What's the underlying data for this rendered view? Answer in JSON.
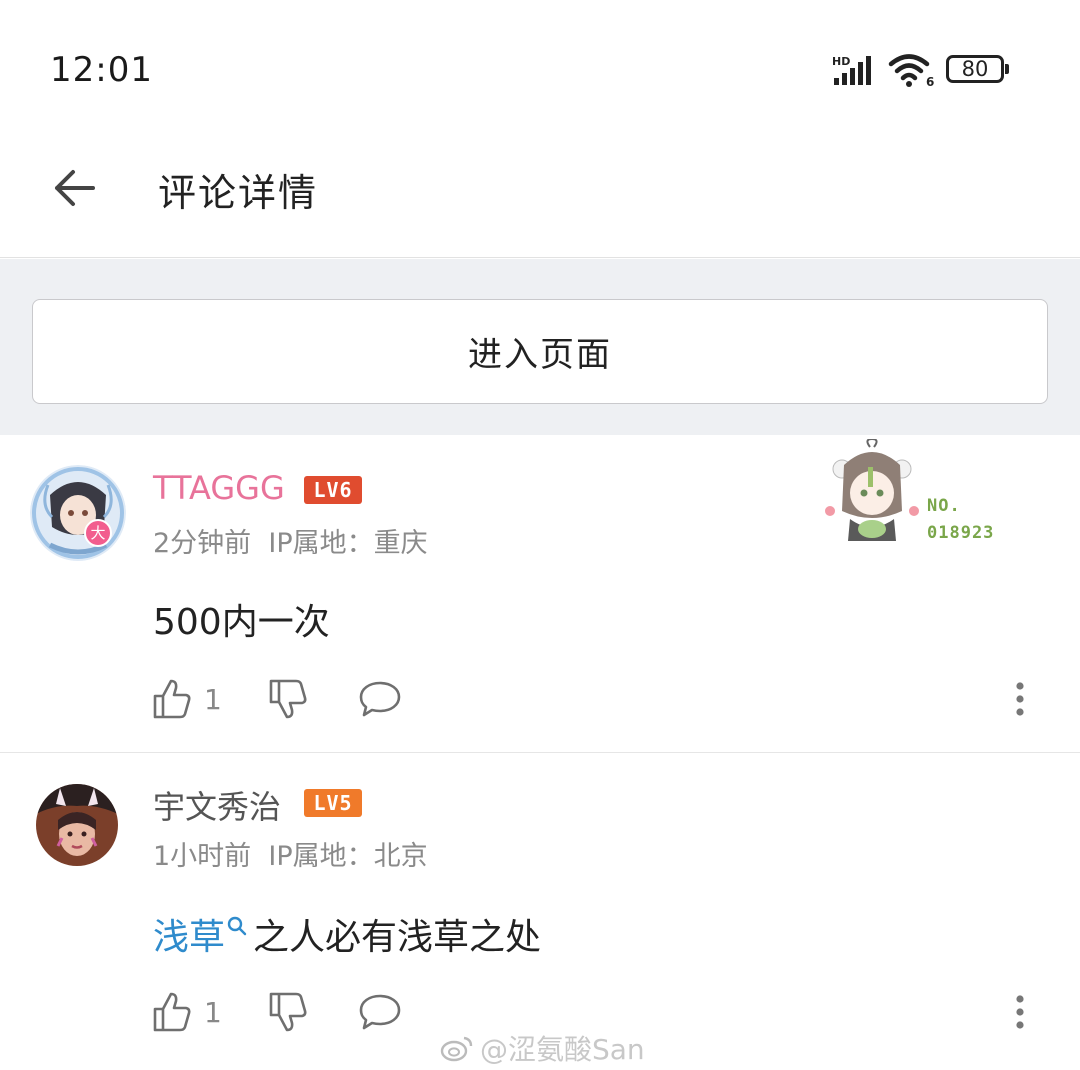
{
  "status_bar": {
    "time": "12:01",
    "network_label": "HD",
    "wifi_label": "6",
    "battery": "80"
  },
  "header": {
    "title": "评论详情"
  },
  "enter_button": {
    "label": "进入页面"
  },
  "comments": [
    {
      "username": "TTAGGG",
      "username_color": "#e8739a",
      "level": "LV6",
      "avatar_badge": "大",
      "time": "2分钟前",
      "ip": "IP属地：重庆",
      "content": "500内一次",
      "likes": "1",
      "fan_card": {
        "no_label": "NO.",
        "number": "018923"
      }
    },
    {
      "username": "宇文秀治",
      "username_color": "#555555",
      "level": "LV5",
      "time": "1小时前",
      "ip": "IP属地：北京",
      "mention": "浅草",
      "content_rest": "之人必有浅草之处",
      "likes": "1"
    }
  ],
  "watermark": "@涩氨酸San",
  "colors": {
    "link": "#2f8bcc",
    "lv6": "#e04c2f",
    "lv5": "#f07a2a",
    "grey_band": "#eef0f3"
  }
}
